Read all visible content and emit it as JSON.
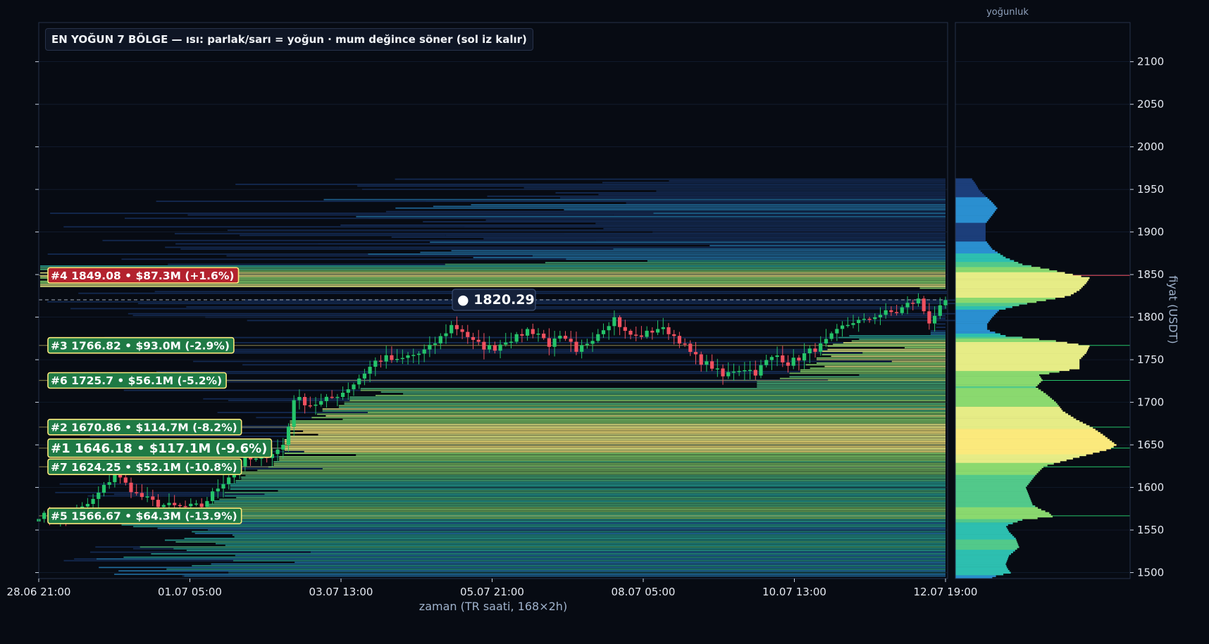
{
  "title": "EN YOĞUN 7 BÖLGE — ısı: parlak/sarı = yoğun · mum değince söner (sol iz kalır)",
  "density_label": "yoğunluk",
  "colors": {
    "bg": "#070b13",
    "up": "#25c46a",
    "down": "#f0505f",
    "hot": "#fbe97c",
    "warm": "#8ad96f",
    "mid": "#2dbfb0",
    "cool": "#2a8fd0",
    "cold": "#1c3e7a"
  },
  "chart_data": {
    "type": "candlestick_with_heatmap",
    "xlabel": "zaman (TR saati, 168×2h)",
    "ylabel": "fiyat (USDT)",
    "ylim": [
      1493,
      2146
    ],
    "y_ticks": [
      1500,
      1550,
      1600,
      1650,
      1700,
      1750,
      1800,
      1850,
      1900,
      1950,
      2000,
      2050,
      2100
    ],
    "x_tick_labels": [
      "28.06 21:00",
      "01.07 05:00",
      "03.07 13:00",
      "05.07 21:00",
      "08.07 05:00",
      "10.07 13:00",
      "12.07 19:00"
    ],
    "bars": 168,
    "current_price": "1820.29",
    "current_price_label": "● 1820.29",
    "close_path": [
      [
        0,
        1567
      ],
      [
        6,
        1566
      ],
      [
        10,
        1585
      ],
      [
        14,
        1616
      ],
      [
        18,
        1592
      ],
      [
        22,
        1580
      ],
      [
        26,
        1577
      ],
      [
        30,
        1578
      ],
      [
        33,
        1600
      ],
      [
        36,
        1620
      ],
      [
        38,
        1633
      ],
      [
        40,
        1632
      ],
      [
        42,
        1638
      ],
      [
        44,
        1644
      ],
      [
        45,
        1650
      ],
      [
        46,
        1672
      ],
      [
        47,
        1705
      ],
      [
        48,
        1703
      ],
      [
        50,
        1697
      ],
      [
        52,
        1700
      ],
      [
        54,
        1706
      ],
      [
        56,
        1712
      ],
      [
        58,
        1722
      ],
      [
        60,
        1735
      ],
      [
        62,
        1748
      ],
      [
        64,
        1752
      ],
      [
        66,
        1748
      ],
      [
        68,
        1754
      ],
      [
        70,
        1757
      ],
      [
        72,
        1764
      ],
      [
        74,
        1776
      ],
      [
        76,
        1790
      ],
      [
        78,
        1784
      ],
      [
        80,
        1771
      ],
      [
        82,
        1765
      ],
      [
        84,
        1764
      ],
      [
        86,
        1773
      ],
      [
        88,
        1776
      ],
      [
        90,
        1785
      ],
      [
        92,
        1781
      ],
      [
        94,
        1768
      ],
      [
        96,
        1775
      ],
      [
        98,
        1768
      ],
      [
        99,
        1756
      ],
      [
        100,
        1765
      ],
      [
        102,
        1776
      ],
      [
        104,
        1788
      ],
      [
        106,
        1799
      ],
      [
        108,
        1782
      ],
      [
        110,
        1777
      ],
      [
        112,
        1781
      ],
      [
        114,
        1787
      ],
      [
        116,
        1783
      ],
      [
        118,
        1773
      ],
      [
        120,
        1758
      ],
      [
        122,
        1748
      ],
      [
        124,
        1742
      ],
      [
        126,
        1730
      ],
      [
        128,
        1738
      ],
      [
        130,
        1740
      ],
      [
        132,
        1735
      ],
      [
        134,
        1748
      ],
      [
        136,
        1755
      ],
      [
        138,
        1746
      ],
      [
        140,
        1752
      ],
      [
        142,
        1760
      ],
      [
        144,
        1766
      ],
      [
        146,
        1777
      ],
      [
        148,
        1788
      ],
      [
        150,
        1795
      ],
      [
        152,
        1795
      ],
      [
        154,
        1802
      ],
      [
        156,
        1805
      ],
      [
        158,
        1806
      ],
      [
        160,
        1815
      ],
      [
        162,
        1820
      ],
      [
        164,
        1795
      ],
      [
        165,
        1803
      ],
      [
        166,
        1810
      ],
      [
        167,
        1820
      ]
    ],
    "zones": [
      {
        "rank": 1,
        "price": 1646.18,
        "label": "#1  1646.18  •  $117.1M  (-9.6%)",
        "color": "#25c46a",
        "primary": true
      },
      {
        "rank": 2,
        "price": 1670.86,
        "label": "#2  1670.86  •  $114.7M  (-8.2%)",
        "color": "#25c46a"
      },
      {
        "rank": 3,
        "price": 1766.82,
        "label": "#3  1766.82  •  $93.0M  (-2.9%)",
        "color": "#25c46a"
      },
      {
        "rank": 4,
        "price": 1849.08,
        "label": "#4  1849.08  •  $87.3M  (+1.6%)",
        "color": "#f0505f"
      },
      {
        "rank": 5,
        "price": 1566.67,
        "label": "#5  1566.67  •  $64.3M  (-13.9%)",
        "color": "#25c46a"
      },
      {
        "rank": 6,
        "price": 1725.7,
        "label": "#6  1725.7  •  $56.1M  (-5.2%)",
        "color": "#25c46a"
      },
      {
        "rank": 7,
        "price": 1624.25,
        "label": "#7  1624.25  •  $52.1M  (-10.8%)",
        "color": "#25c46a"
      }
    ],
    "density_profile": [
      [
        1495,
        0.22
      ],
      [
        1500,
        0.33
      ],
      [
        1505,
        0.31
      ],
      [
        1510,
        0.3
      ],
      [
        1520,
        0.32
      ],
      [
        1530,
        0.38
      ],
      [
        1540,
        0.36
      ],
      [
        1548,
        0.32
      ],
      [
        1555,
        0.3
      ],
      [
        1562,
        0.4
      ],
      [
        1566,
        0.58
      ],
      [
        1570,
        0.56
      ],
      [
        1575,
        0.5
      ],
      [
        1580,
        0.46
      ],
      [
        1590,
        0.44
      ],
      [
        1600,
        0.42
      ],
      [
        1605,
        0.44
      ],
      [
        1615,
        0.48
      ],
      [
        1625,
        0.53
      ],
      [
        1635,
        0.72
      ],
      [
        1645,
        0.92
      ],
      [
        1650,
        0.96
      ],
      [
        1656,
        0.92
      ],
      [
        1662,
        0.88
      ],
      [
        1670,
        0.82
      ],
      [
        1680,
        0.72
      ],
      [
        1690,
        0.64
      ],
      [
        1700,
        0.6
      ],
      [
        1710,
        0.54
      ],
      [
        1718,
        0.48
      ],
      [
        1726,
        0.52
      ],
      [
        1732,
        0.5
      ],
      [
        1740,
        0.74
      ],
      [
        1750,
        0.74
      ],
      [
        1758,
        0.78
      ],
      [
        1766,
        0.8
      ],
      [
        1772,
        0.6
      ],
      [
        1778,
        0.3
      ],
      [
        1785,
        0.19
      ],
      [
        1792,
        0.19
      ],
      [
        1800,
        0.22
      ],
      [
        1808,
        0.26
      ],
      [
        1815,
        0.4
      ],
      [
        1825,
        0.68
      ],
      [
        1832,
        0.74
      ],
      [
        1840,
        0.78
      ],
      [
        1846,
        0.8
      ],
      [
        1850,
        0.7
      ],
      [
        1856,
        0.56
      ],
      [
        1862,
        0.4
      ],
      [
        1870,
        0.3
      ],
      [
        1880,
        0.22
      ],
      [
        1890,
        0.18
      ],
      [
        1900,
        0.18
      ],
      [
        1910,
        0.18
      ],
      [
        1920,
        0.22
      ],
      [
        1928,
        0.25
      ],
      [
        1935,
        0.22
      ],
      [
        1942,
        0.18
      ],
      [
        1950,
        0.14
      ],
      [
        1957,
        0.12
      ],
      [
        1962,
        0.1
      ]
    ]
  }
}
